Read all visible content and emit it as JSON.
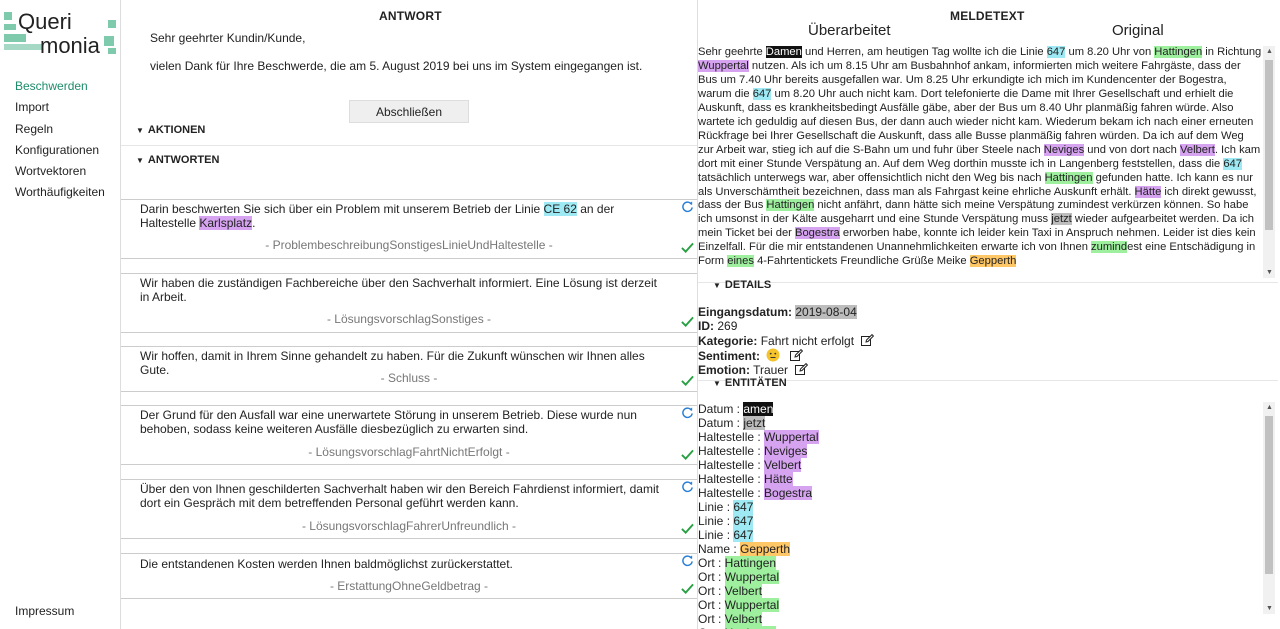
{
  "sidebar": {
    "logo_line1": "Queri",
    "logo_line2": "monia",
    "nav": [
      "Beschwerden",
      "Import",
      "Regeln",
      "Konfigurationen",
      "Wortvektoren",
      "Worthäufigkeiten"
    ],
    "active_nav": "Beschwerden",
    "footer_link": "Impressum"
  },
  "antwort": {
    "title": "ANTWORT",
    "greeting": "Sehr geehrter Kundin/Kunde,",
    "intro": "vielen Dank für Ihre Beschwerde, die am 5. August 2019 bei uns im System eingegangen ist.",
    "finish_button": "Abschließen",
    "sections": {
      "actions": "AKTIONEN",
      "answers": "ANTWORTEN"
    },
    "cards": [
      {
        "parts": [
          "Darin beschwerten Sie sich über ein Problem mit unserem Betrieb der Linie ",
          "CE 62",
          " an der Haltestelle ",
          "Karlsplatz",
          "."
        ],
        "tag": "- ProblembeschreibungSonstigesLinieUndHaltestelle -"
      },
      {
        "text": "Wir haben die zuständigen Fachbereiche über den Sachverhalt informiert. Eine Lösung ist derzeit in Arbeit.",
        "tag": "- LösungsvorschlagSonstiges -"
      },
      {
        "text": "Wir hoffen, damit in Ihrem Sinne gehandelt zu haben. Für die Zukunft wünschen wir Ihnen alles Gute.",
        "tag": "- Schluss -"
      },
      {
        "text": "Der Grund für den Ausfall war eine unerwartete Störung in unserem Betrieb. Diese wurde nun behoben, sodass keine weiteren Ausfälle diesbezüglich zu erwarten sind.",
        "tag": "- LösungsvorschlagFahrtNichtErfolgt -"
      },
      {
        "text": "Über den von Ihnen geschilderten Sachverhalt haben wir den Bereich Fahrdienst informiert, damit dort ein Gespräch mit dem betreffenden Personal geführt werden kann.",
        "tag": "- LösungsvorschlagFahrerUnfreundlich -"
      },
      {
        "text": "Die entstandenen Kosten werden Ihnen baldmöglichst zurückerstattet.",
        "tag": "- ErstattungOhneGeldbetrag -"
      }
    ]
  },
  "meldetext": {
    "title": "MELDETEXT",
    "tab_revised": "Überarbeitet",
    "tab_original": "Original",
    "segments": [
      {
        "t": "Sehr geehrte "
      },
      {
        "t": "Damen",
        "h": "black"
      },
      {
        "t": " und Herren, am heutigen Tag wollte ich die Linie "
      },
      {
        "t": "647",
        "h": "cyan"
      },
      {
        "t": " um 8.20 Uhr von "
      },
      {
        "t": "Hattingen",
        "h": "green"
      },
      {
        "t": " in Richtung "
      },
      {
        "t": "Wuppertal",
        "h": "purple"
      },
      {
        "t": " nutzen. Als ich um 8.15 Uhr am Busbahnhof ankam, informierten mich weitere Fahrgäste, dass der Bus um 7.40 Uhr bereits ausgefallen war. Um 8.25 Uhr erkundigte ich mich im Kundencenter der Bogestra, warum die "
      },
      {
        "t": "647",
        "h": "cyan"
      },
      {
        "t": " um 8.20 Uhr auch nicht kam. Dort telefonierte die Dame mit Ihrer Gesellschaft und erhielt die Auskunft, dass es krankheitsbedingt Ausfälle gäbe, aber der Bus um 8.40 Uhr planmäßig fahren würde. Also wartete ich geduldig auf diesen Bus, der dann auch wieder nicht kam. Wiederum bekam ich nach einer erneuten Rückfrage bei Ihrer Gesellschaft die Auskunft, dass alle Busse planmäßig fahren würden. Da ich auf dem Weg zur Arbeit war, stieg ich auf die S-Bahn um und fuhr über Steele nach "
      },
      {
        "t": "Neviges",
        "h": "purple"
      },
      {
        "t": " und von dort nach "
      },
      {
        "t": "Velbert",
        "h": "purple"
      },
      {
        "t": ". Ich kam dort mit einer Stunde Verspätung an. Auf dem Weg dorthin musste ich in Langenberg feststellen, dass die "
      },
      {
        "t": "647",
        "h": "cyan"
      },
      {
        "t": " tatsächlich unterwegs war, aber offensichtlich nicht den Weg bis nach "
      },
      {
        "t": "Hattingen",
        "h": "green"
      },
      {
        "t": " gefunden hatte. Ich kann es nur als Unverschämtheit bezeichnen, dass man als Fahrgast keine ehrliche Auskunft erhält. "
      },
      {
        "t": "Hätte",
        "h": "purple"
      },
      {
        "t": " ich direkt gewusst, dass der Bus "
      },
      {
        "t": "Hattingen",
        "h": "green"
      },
      {
        "t": " nicht anfährt, dann hätte sich meine Verspätung zumindest verkürzen können. So habe ich umsonst in der Kälte ausgeharrt und eine Stunde Verspätung muss "
      },
      {
        "t": "jetzt",
        "h": "gray"
      },
      {
        "t": " wieder aufgearbeitet werden. Da ich mein Ticket bei der "
      },
      {
        "t": "Bogestra",
        "h": "purple"
      },
      {
        "t": " erworben habe, konnte ich leider kein Taxi in Anspruch nehmen. Leider ist dies kein Einzelfall. Für die mir entstandenen Unannehmlichkeiten erwarte ich von Ihnen "
      },
      {
        "t": "zumind",
        "h": "green"
      },
      {
        "t": "est eine Entschädigung in Form "
      },
      {
        "t": "eines",
        "h": "green"
      },
      {
        "t": " 4-Fahrtentickets Freundliche Grüße Meike "
      },
      {
        "t": "Gepperth",
        "h": "orange"
      }
    ],
    "details_title": "DETAILS",
    "details": {
      "eingangsdatum_label": "Eingangsdatum:",
      "eingangsdatum_value": "2019-08-04",
      "id_label": "ID:",
      "id_value": "269",
      "kategorie_label": "Kategorie:",
      "kategorie_value": "Fahrt nicht erfolgt",
      "sentiment_label": "Sentiment:",
      "emotion_label": "Emotion:",
      "emotion_value": "Trauer"
    },
    "entities_title": "ENTITÄTEN",
    "entities": [
      {
        "type": "Datum",
        "value": "amen",
        "h": "black"
      },
      {
        "type": "Datum",
        "value": "jetzt",
        "h": "gray"
      },
      {
        "type": "Haltestelle",
        "value": "Wuppertal",
        "h": "purple"
      },
      {
        "type": "Haltestelle",
        "value": "Neviges",
        "h": "purple"
      },
      {
        "type": "Haltestelle",
        "value": "Velbert",
        "h": "purple"
      },
      {
        "type": "Haltestelle",
        "value": "Hätte",
        "h": "purple"
      },
      {
        "type": "Haltestelle",
        "value": "Bogestra",
        "h": "purple"
      },
      {
        "type": "Linie",
        "value": "647",
        "h": "cyan"
      },
      {
        "type": "Linie",
        "value": "647",
        "h": "cyan"
      },
      {
        "type": "Linie",
        "value": "647",
        "h": "cyan"
      },
      {
        "type": "Name",
        "value": "Gepperth",
        "h": "orange"
      },
      {
        "type": "Ort",
        "value": "Hattingen",
        "h": "green"
      },
      {
        "type": "Ort",
        "value": "Wuppertal",
        "h": "green"
      },
      {
        "type": "Ort",
        "value": "Velbert",
        "h": "green"
      },
      {
        "type": "Ort",
        "value": "Wuppertal",
        "h": "green"
      },
      {
        "type": "Ort",
        "value": "Velbert",
        "h": "green"
      },
      {
        "type": "Ort",
        "value": "Hattingen",
        "h": "green"
      }
    ]
  },
  "colors": {
    "accent": "#1e8c6a",
    "cyan": "#9ee9f3",
    "purple": "#d6a3f0",
    "green": "#9ef09f",
    "orange": "#ffc766",
    "gray": "#bdbdbd"
  }
}
